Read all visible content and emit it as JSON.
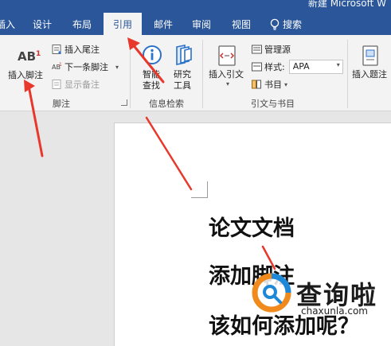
{
  "window": {
    "title": "新建 Microsoft W"
  },
  "tabs": [
    {
      "label": "插入",
      "active": false
    },
    {
      "label": "设计",
      "active": false
    },
    {
      "label": "布局",
      "active": false
    },
    {
      "label": "引用",
      "active": true
    },
    {
      "label": "邮件",
      "active": false
    },
    {
      "label": "审阅",
      "active": false
    },
    {
      "label": "视图",
      "active": false
    }
  ],
  "search_tab": {
    "label": "搜索",
    "icon": "lightbulb-icon"
  },
  "ribbon": {
    "footnotes": {
      "insert_footnote": {
        "label": "插入脚注",
        "icon_text": "AB",
        "icon_sup": "1"
      },
      "insert_endnote": "插入尾注",
      "next_footnote": "下一条脚注",
      "show_notes": "显示备注",
      "group_label": "脚注"
    },
    "research": {
      "smart_lookup": "智能\n查找",
      "researcher": "研究\n工具",
      "group_label": "信息检索"
    },
    "citations": {
      "insert_citation": "插入引文",
      "manage_sources": "管理源",
      "style_label": "样式:",
      "style_value": "APA",
      "bibliography": "书目",
      "group_label": "引文与书目"
    },
    "captions": {
      "insert_caption": "插入题注"
    }
  },
  "document": {
    "lines": [
      "论文文档",
      "添加脚注",
      "该如何添加呢？"
    ]
  },
  "watermark": {
    "name": "查询啦",
    "url": "chaxunla.com"
  },
  "colors": {
    "ribbon_blue": "#2b579a",
    "arrow_red": "#e8382c",
    "watermark_orange": "#f08a1c",
    "watermark_blue": "#1e88d8"
  }
}
